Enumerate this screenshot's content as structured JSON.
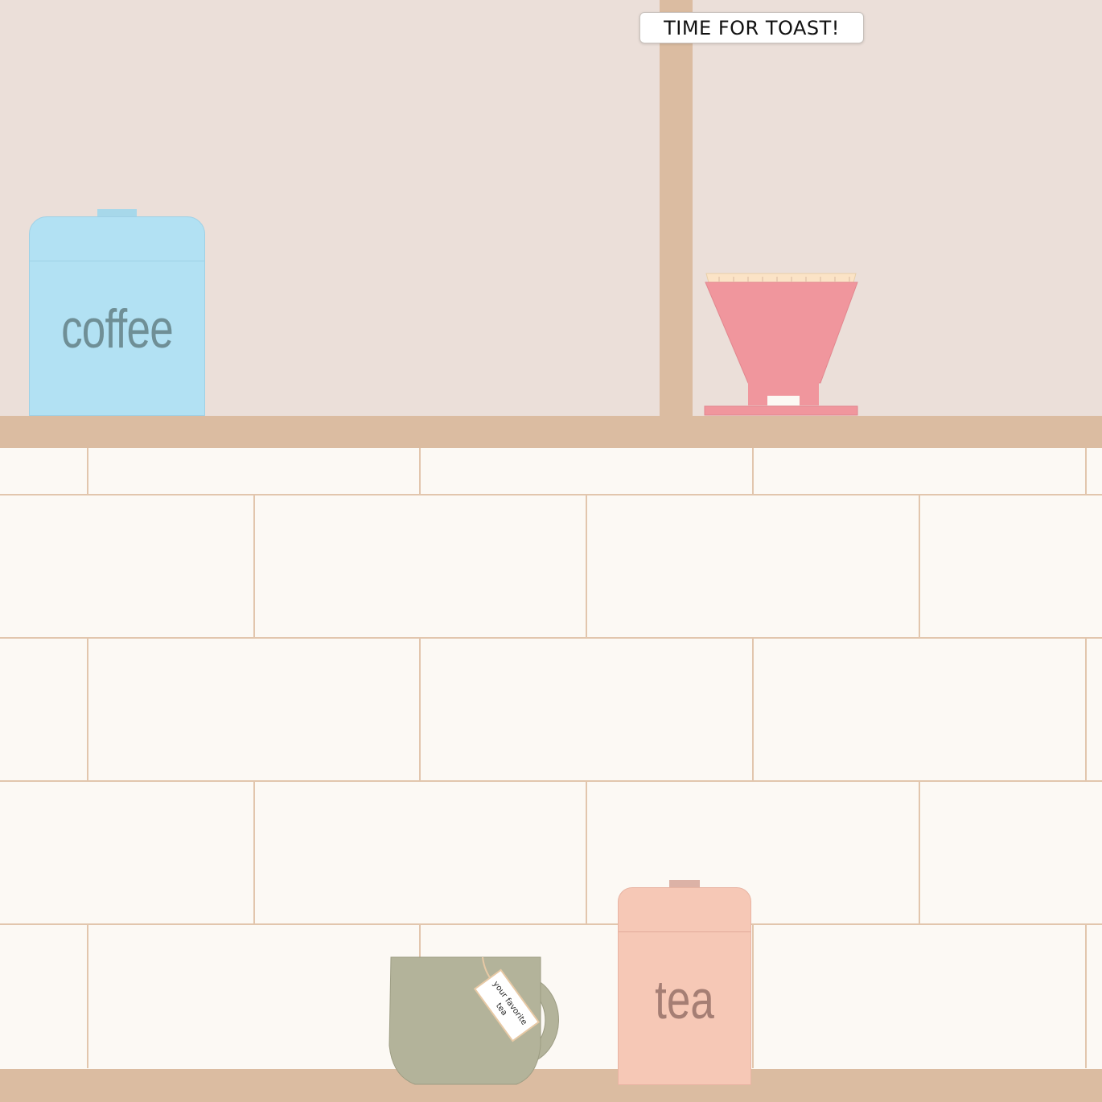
{
  "toast_button": {
    "label": "TIME FOR TOAST!"
  },
  "coffee_canister": {
    "label": "coffee",
    "color": "#b2e1f3"
  },
  "tea_canister": {
    "label": "tea",
    "color": "#f6c8b6"
  },
  "mug": {
    "tag_line1": "your favorite",
    "tag_line2": "tea",
    "color": "#b3b39a"
  },
  "dripper": {
    "color": "#f0969d",
    "filter_color": "#fbe3c6"
  },
  "colors": {
    "wall": "#ebdfd9",
    "wood": "#dbbca1",
    "tile": "#fcf9f4",
    "grout": "#e2c6ad"
  }
}
